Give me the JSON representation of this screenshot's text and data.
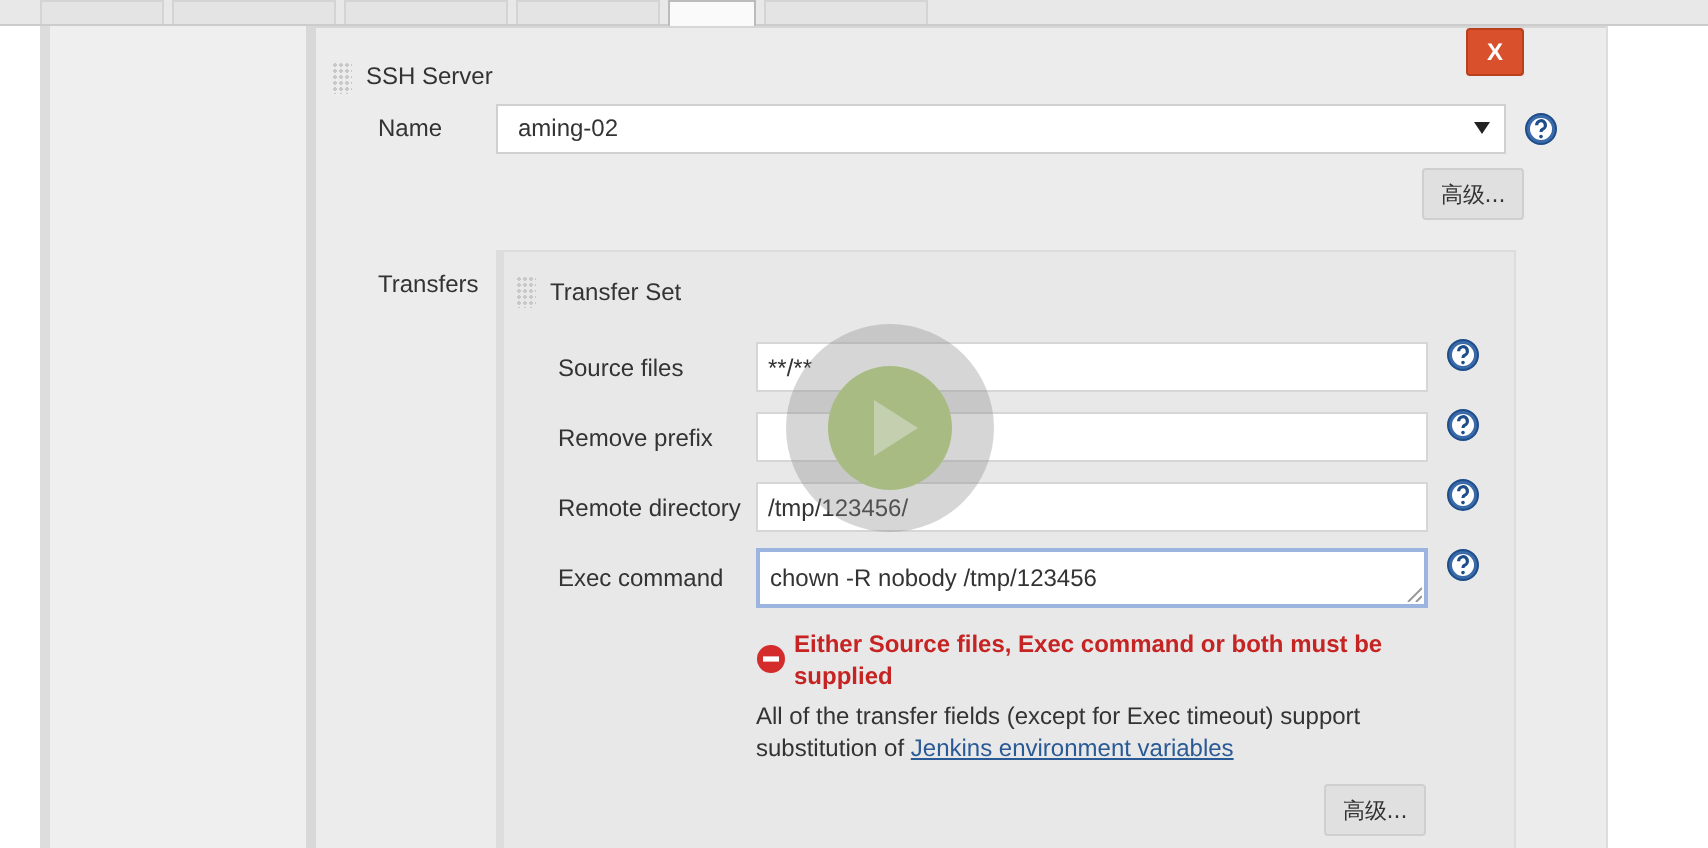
{
  "tabs": [
    {
      "selected": false
    },
    {
      "selected": false
    },
    {
      "selected": false
    },
    {
      "selected": false
    },
    {
      "selected": true
    },
    {
      "selected": false
    }
  ],
  "ssh_server": {
    "title": "SSH Server",
    "delete_button": "X",
    "name_label": "Name",
    "name_value": "aming-02",
    "advanced_button": "高级...",
    "transfers_label": "Transfers",
    "transfer_set": {
      "title": "Transfer Set",
      "fields": [
        {
          "label": "Source files",
          "value": "**/**",
          "kind": "input"
        },
        {
          "label": "Remove prefix",
          "kind": "input"
        },
        {
          "label": "Remote directory",
          "value": "/tmp/123456/",
          "kind": "input"
        },
        {
          "label": "Exec command",
          "value": "chown -R nobody /tmp/123456",
          "kind": "textarea"
        }
      ],
      "error": "Either Source files, Exec command or both must be supplied",
      "note": "All of the transfer fields (except for Exec timeout) support substitution of",
      "note_link": "Jenkins environment variables",
      "advanced_button": "高级..."
    }
  }
}
